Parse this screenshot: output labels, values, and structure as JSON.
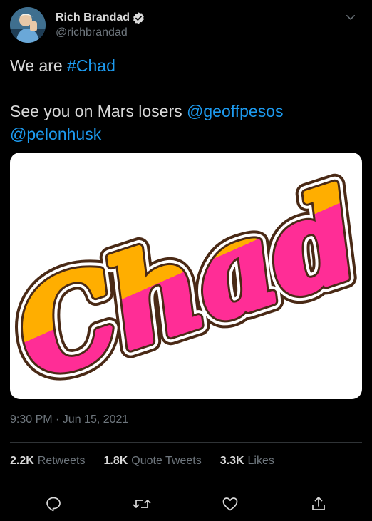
{
  "author": {
    "display_name": "Rich Brandad",
    "handle": "@richbrandad",
    "verified": true
  },
  "tweet": {
    "line1_prefix": "We are ",
    "hashtag": "#Chad",
    "line2_prefix": "See you on Mars losers ",
    "mention1": "@geoffpesos",
    "mention2": "@pelonhusk",
    "image_text": "Chad",
    "timestamp": "9:30 PM · Jun 15, 2021"
  },
  "stats": {
    "retweets_count": "2.2K",
    "retweets_label": "Retweets",
    "quote_count": "1.8K",
    "quote_label": "Quote Tweets",
    "likes_count": "3.3K",
    "likes_label": "Likes"
  },
  "icons": {
    "menu": "chevron-down-icon",
    "verified": "verified-badge-icon",
    "reply": "reply-icon",
    "retweet": "retweet-icon",
    "like": "heart-icon",
    "share": "share-icon"
  },
  "colors": {
    "background": "#000000",
    "link": "#1d9bf0",
    "text": "#d9d9d9",
    "muted": "#6e767d",
    "divider": "#2f3336",
    "chad_orange": "#ffae00",
    "chad_pink": "#ff2d96",
    "chad_outline": "#4a2a16"
  }
}
